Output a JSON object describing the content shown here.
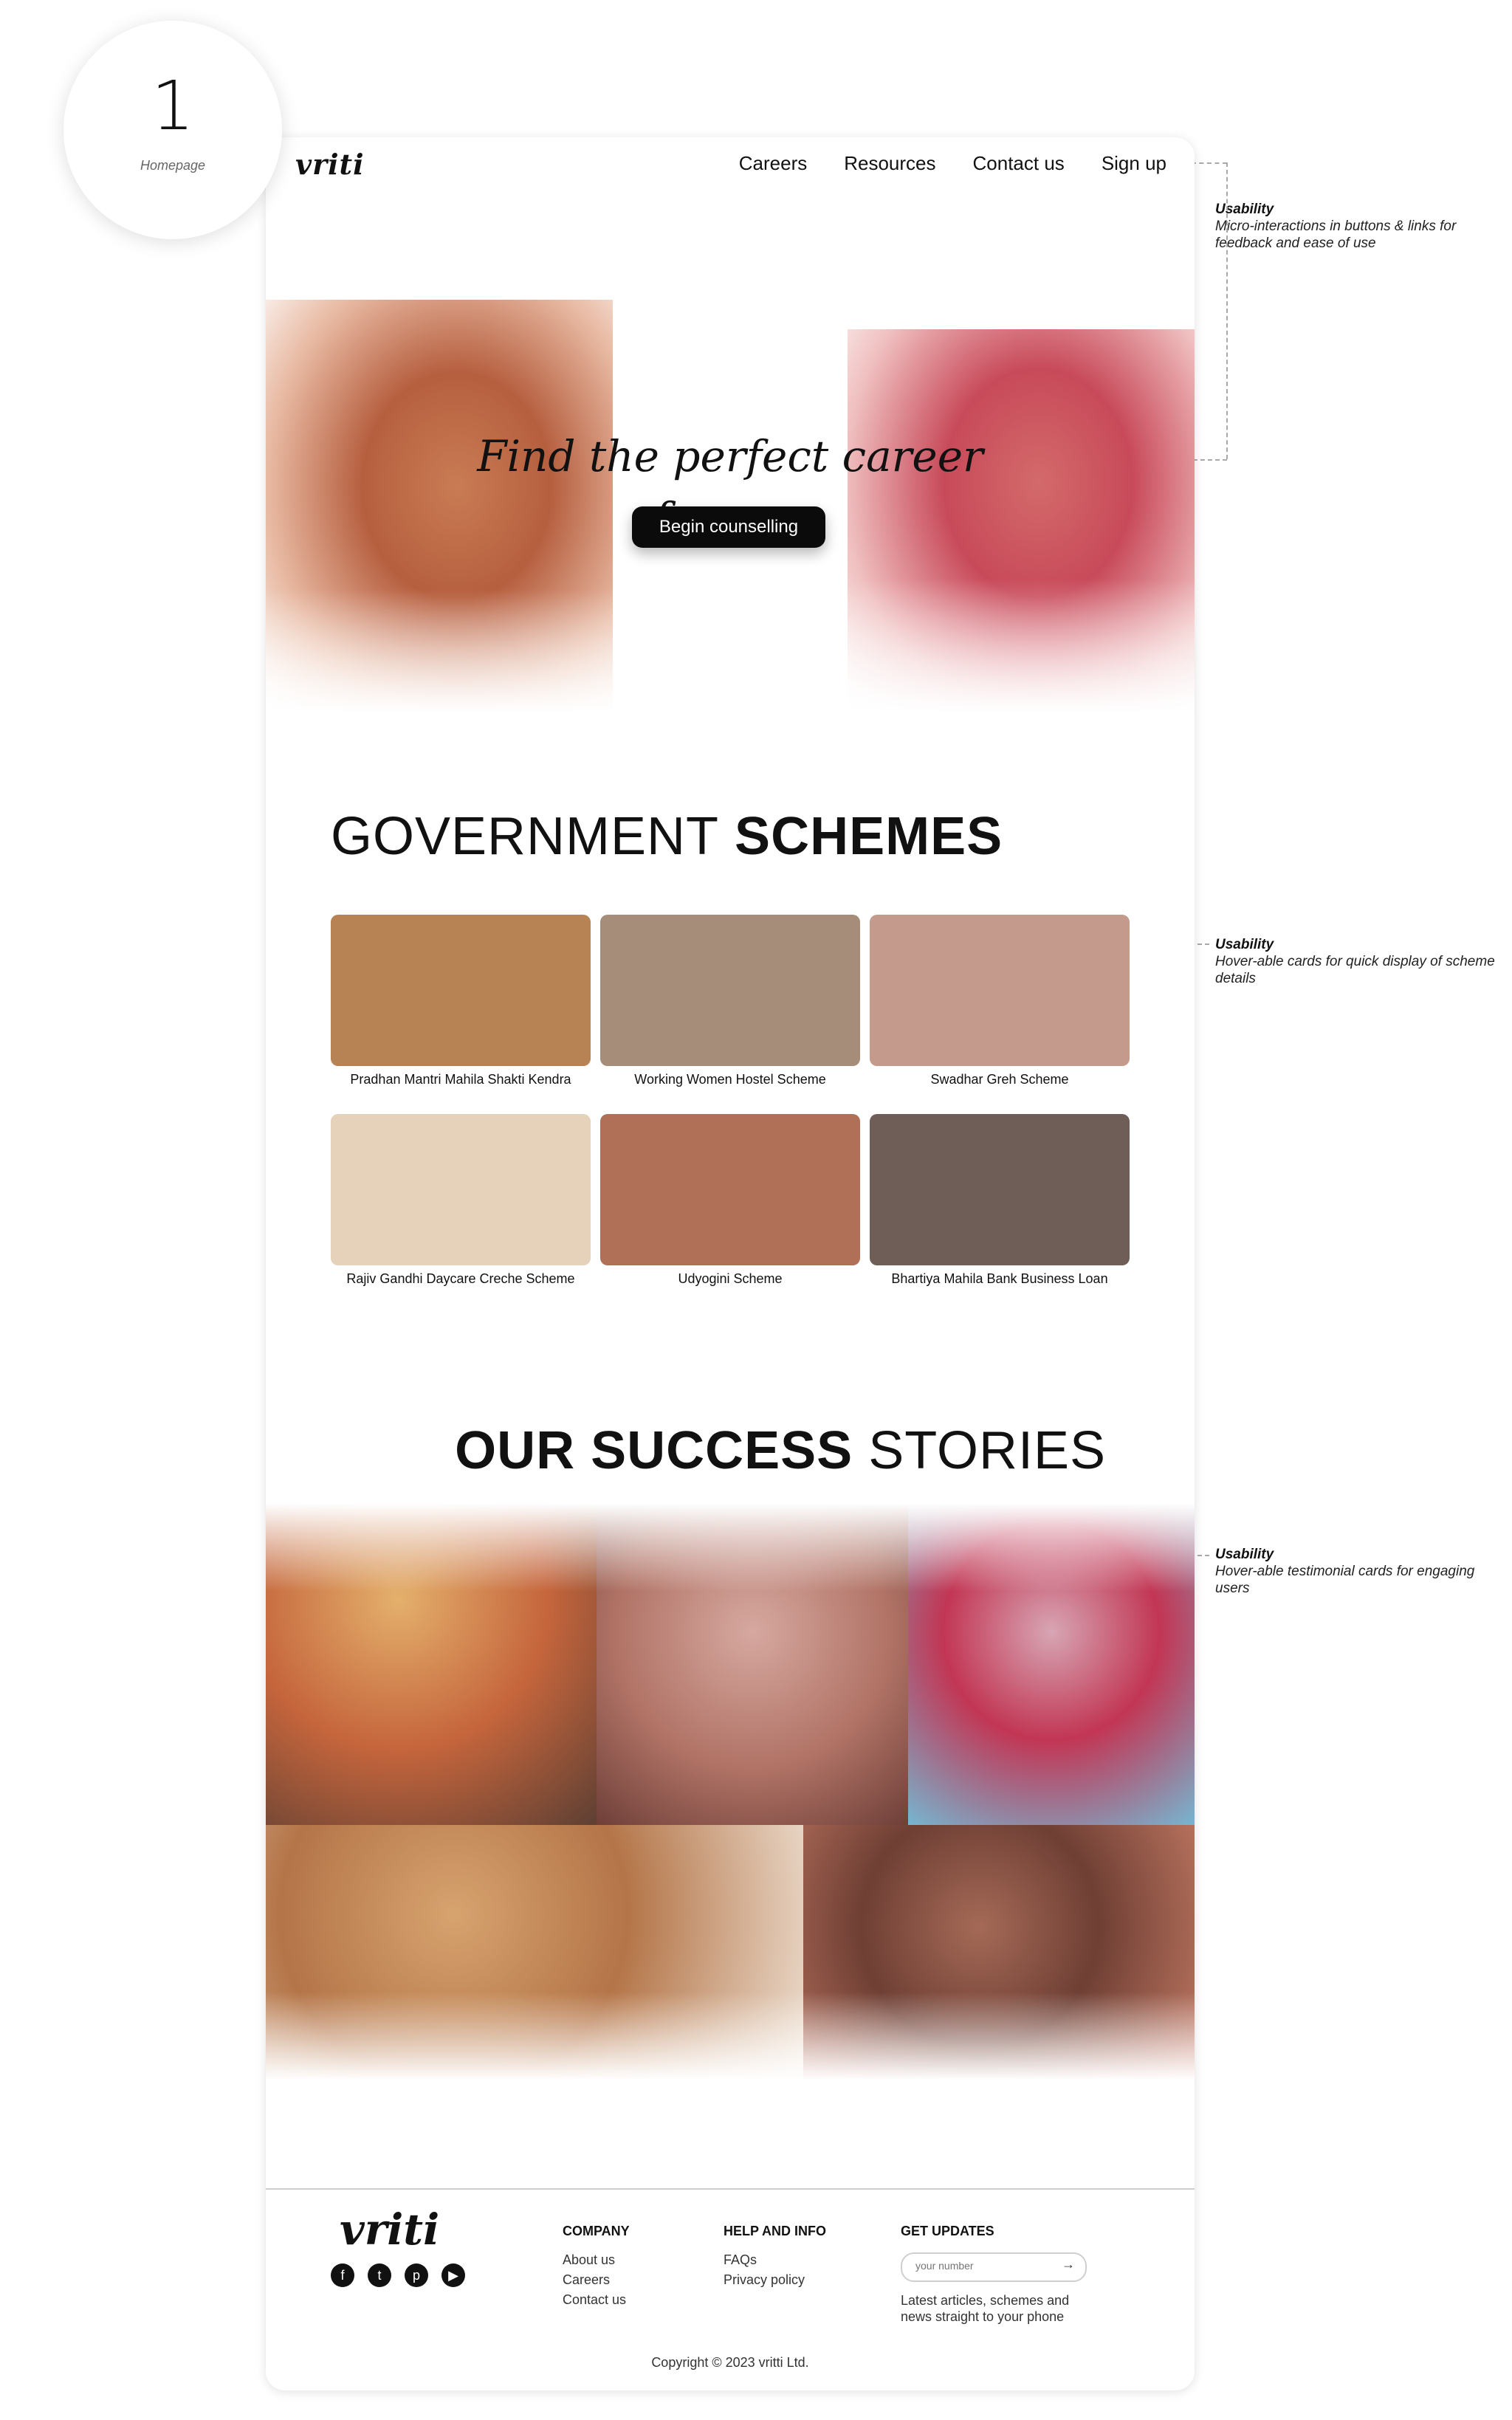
{
  "page_marker": {
    "number": "1",
    "label": "Homepage"
  },
  "brand": {
    "logo": "vriti"
  },
  "nav": {
    "items": [
      "Careers",
      "Resources",
      "Contact us",
      "Sign up"
    ]
  },
  "hero": {
    "title_line1": "Find the perfect career",
    "title_line2": "for you",
    "button": "Begin counselling"
  },
  "schemes": {
    "title_light": "GOVERNMENT",
    "title_bold": "SCHEMES",
    "cards": [
      {
        "label": "Pradhan Mantri Mahila Shakti Kendra",
        "color": "#b88354"
      },
      {
        "label": "Working Women Hostel Scheme",
        "color": "#a68d79"
      },
      {
        "label": "Swadhar Greh Scheme",
        "color": "#c49a8d"
      },
      {
        "label": "Rajiv Gandhi Daycare Creche Scheme",
        "color": "#e6d1bb"
      },
      {
        "label": "Udyogini Scheme",
        "color": "#b07058"
      },
      {
        "label": "Bhartiya Mahila Bank Business Loan",
        "color": "#6f5e57"
      }
    ]
  },
  "stories": {
    "title_bold": "OUR SUCCESS",
    "title_light": "STORIES"
  },
  "footer": {
    "logo": "vriti",
    "company": {
      "heading": "COMPANY",
      "items": [
        "About us",
        "Careers",
        "Contact us"
      ]
    },
    "help": {
      "heading": "HELP AND INFO",
      "items": [
        "FAQs",
        "Privacy policy"
      ]
    },
    "updates": {
      "heading": "GET UPDATES",
      "placeholder": "your number",
      "text": "Latest articles, schemes and news straight to your phone"
    },
    "copyright": "Copyright © 2023 vritti Ltd."
  },
  "annotations": [
    {
      "title": "Usability",
      "body": "Micro-interactions in buttons & links for feedback and ease of use"
    },
    {
      "title": "Usability",
      "body": "Hover-able cards for quick display of scheme details"
    },
    {
      "title": "Usability",
      "body": "Hover-able testimonial cards for engaging users"
    }
  ]
}
